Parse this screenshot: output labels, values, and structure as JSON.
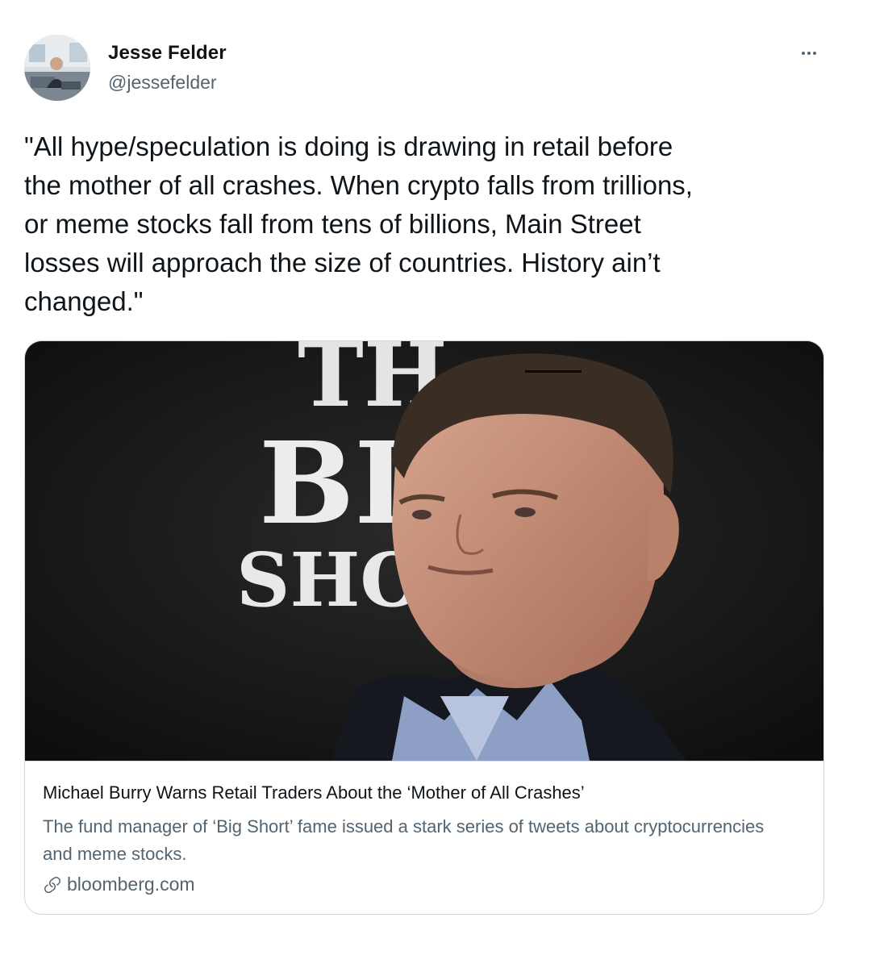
{
  "author": {
    "name": "Jesse Felder",
    "handle": "@jessefelder"
  },
  "tweet": {
    "text": "\"All hype/speculation is doing is drawing in retail before\nthe mother of all crashes. When crypto falls from trillions,\nor meme stocks fall from tens of billions, Main Street\nlosses will approach the size of countries. History ain’t\nchanged.\""
  },
  "card": {
    "image_text": {
      "line1": "TH",
      "line2": "BI",
      "line3": "SHO"
    },
    "title": "Michael Burry Warns Retail Traders About the ‘Mother of All Crashes’",
    "description": "The fund manager of ‘Big Short’ fame issued a stark series of tweets about cryptocurrencies and meme stocks.",
    "domain": "bloomberg.com"
  },
  "icons": {
    "more": "more-options-icon",
    "link": "link-icon"
  },
  "colors": {
    "text_primary": "#0f1419",
    "text_secondary": "#536471",
    "card_border": "#cfd9de"
  }
}
